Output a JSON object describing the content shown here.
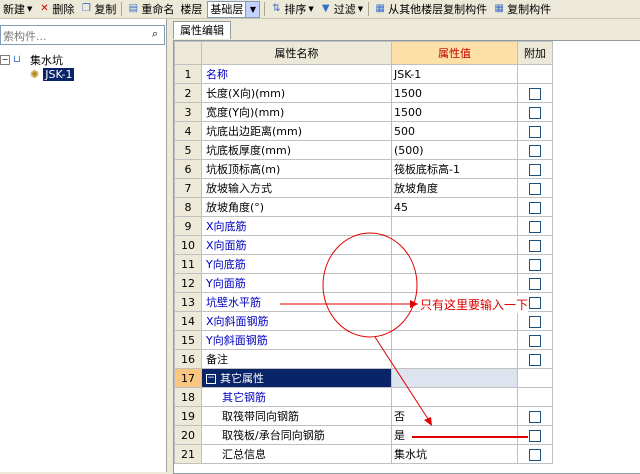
{
  "toolbar": {
    "new": "新建",
    "delete": "删除",
    "copy": "复制",
    "rename": "重命名",
    "floor": "楼层",
    "floor_value": "基础层",
    "sort": "排序",
    "filter": "过滤",
    "copy_from_floor": "从其他楼层复制构件",
    "copy_component": "复制构件"
  },
  "left_panel": {
    "search_placeholder": "索构件...",
    "tree_root": "集水坑",
    "tree_child": "JSK-1"
  },
  "tab": "属性编辑",
  "grid": {
    "headers": {
      "name": "属性名称",
      "value": "属性值",
      "extra": "附加"
    },
    "rows": [
      {
        "num": "1",
        "name": "名称",
        "value": "JSK-1"
      },
      {
        "num": "2",
        "name": "长度(X向)(mm)",
        "value": "1500"
      },
      {
        "num": "3",
        "name": "宽度(Y向)(mm)",
        "value": "1500"
      },
      {
        "num": "4",
        "name": "坑底出边距离(mm)",
        "value": "500"
      },
      {
        "num": "5",
        "name": "坑底板厚度(mm)",
        "value": "(500)"
      },
      {
        "num": "6",
        "name": "坑板顶标高(m)",
        "value": "筏板底标高-1"
      },
      {
        "num": "7",
        "name": "放坡输入方式",
        "value": "放坡角度"
      },
      {
        "num": "8",
        "name": "放坡角度(°)",
        "value": "45"
      },
      {
        "num": "9",
        "name": "X向底筋",
        "value": ""
      },
      {
        "num": "10",
        "name": "X向面筋",
        "value": ""
      },
      {
        "num": "11",
        "name": "Y向底筋",
        "value": ""
      },
      {
        "num": "12",
        "name": "Y向面筋",
        "value": ""
      },
      {
        "num": "13",
        "name": "坑壁水平筋",
        "value": ""
      },
      {
        "num": "14",
        "name": "X向斜面钢筋",
        "value": ""
      },
      {
        "num": "15",
        "name": "Y向斜面钢筋",
        "value": ""
      },
      {
        "num": "16",
        "name": "备注",
        "value": ""
      },
      {
        "num": "17",
        "name": "其它属性",
        "value": ""
      },
      {
        "num": "18",
        "name": "其它钢筋",
        "value": ""
      },
      {
        "num": "19",
        "name": "取筏带同向钢筋",
        "value": "否"
      },
      {
        "num": "20",
        "name": "取筏板/承台同向钢筋",
        "value": "是"
      },
      {
        "num": "21",
        "name": "汇总信息",
        "value": "集水坑"
      }
    ]
  },
  "annotation": "只有这里要输入一下",
  "colors": {
    "annotation": "#e00000",
    "selection": "#0a246a",
    "header_value": "#c00000"
  }
}
